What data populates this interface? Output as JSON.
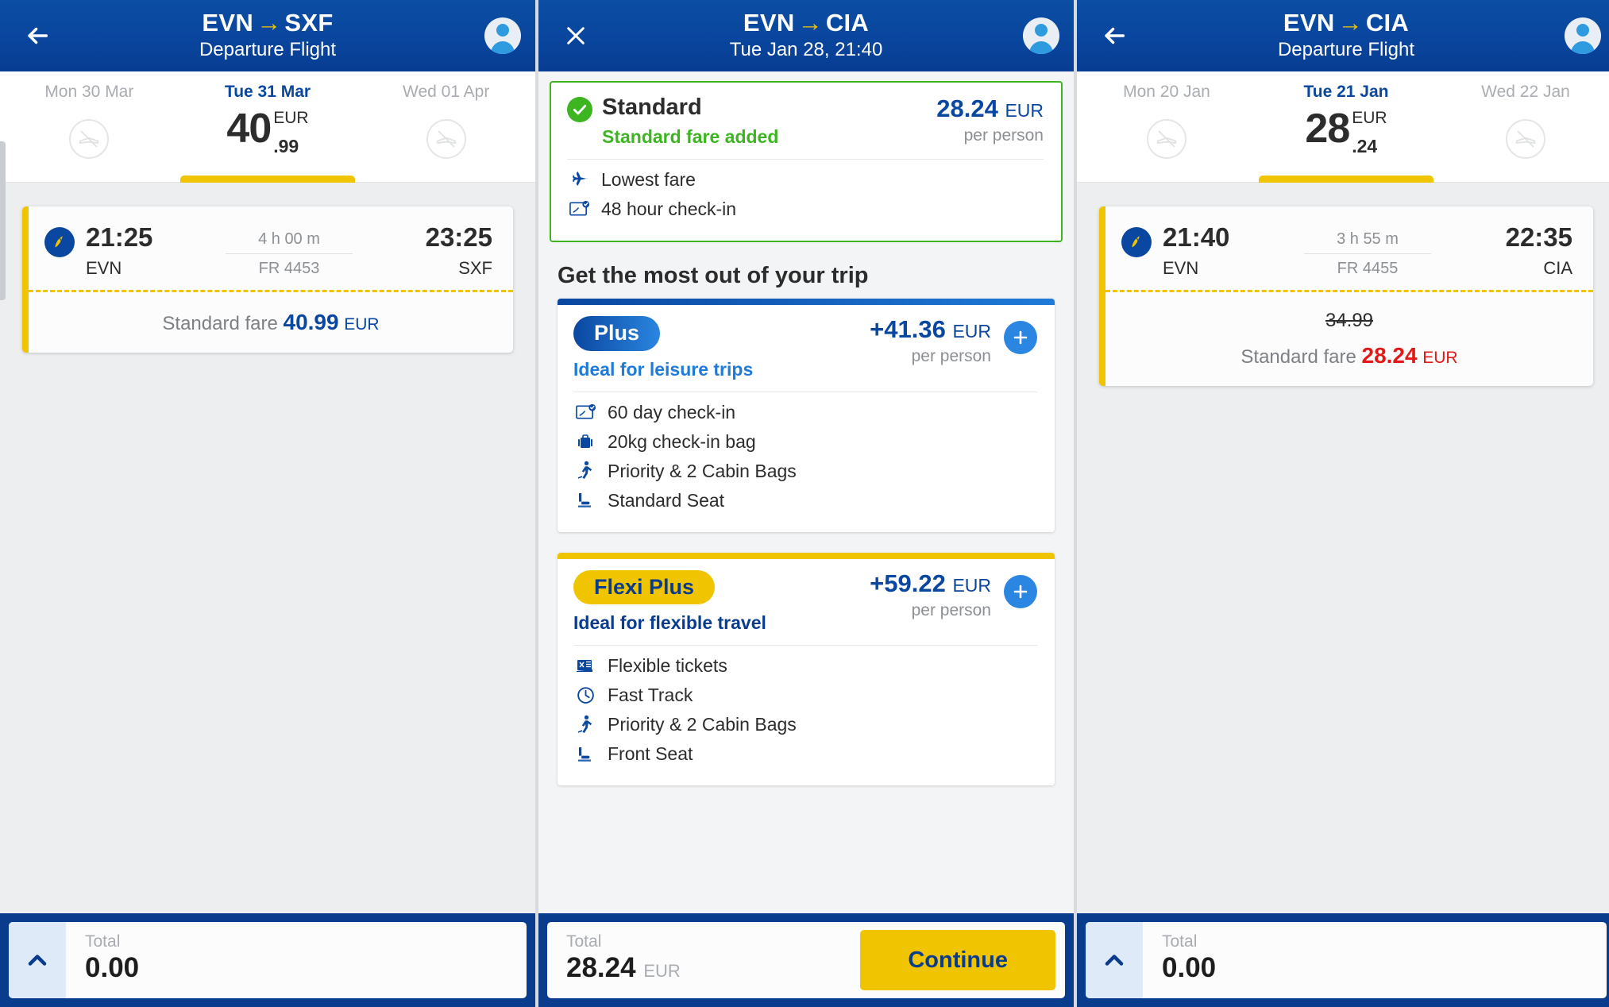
{
  "panels": {
    "left": {
      "header": {
        "back_icon": "back-arrow-icon",
        "route_from": "EVN",
        "route_arrow": "→",
        "route_to": "SXF",
        "subtitle": "Departure Flight",
        "avatar_icon": "account-avatar-icon"
      },
      "dates": [
        {
          "label": "Mon 30 Mar",
          "active": false,
          "no_flight": true
        },
        {
          "label": "Tue 31 Mar",
          "active": true,
          "price_int": "40",
          "price_cur": "EUR",
          "price_dec": ".99"
        },
        {
          "label": "Wed 01 Apr",
          "active": false,
          "no_flight": true
        }
      ],
      "flight": {
        "depart_time": "21:25",
        "depart_airport": "EVN",
        "duration": "4 h 00 m",
        "flight_no": "FR 4453",
        "arrive_time": "23:25",
        "arrive_airport": "SXF",
        "fare_label": "Standard fare",
        "fare_amount": "40.99",
        "fare_currency": "EUR"
      },
      "bottom": {
        "chevron_icon": "chevron-up-icon",
        "total_label": "Total",
        "total_value": "0.00"
      }
    },
    "center": {
      "header": {
        "close_icon": "close-x-icon",
        "route_from": "EVN",
        "route_arrow": "→",
        "route_to": "CIA",
        "subtitle": "Tue Jan 28, 21:40",
        "avatar_icon": "account-avatar-icon"
      },
      "standard": {
        "check_icon": "check-circle-icon",
        "title": "Standard",
        "added_text": "Standard fare added",
        "price": "28.24",
        "currency": "EUR",
        "per_person": "per person",
        "features": [
          {
            "icon": "airplane-icon",
            "label": "Lowest fare"
          },
          {
            "icon": "boarding-pass-check-icon",
            "label": "48 hour check-in"
          }
        ]
      },
      "section_title": "Get the most out of your trip",
      "upgrades": [
        {
          "badge": "Plus",
          "subtitle": "Ideal for leisure trips",
          "price": "+41.36",
          "currency": "EUR",
          "per_person": "per person",
          "add_icon": "plus-circle-icon",
          "features": [
            {
              "icon": "boarding-pass-check-icon",
              "label": "60 day check-in"
            },
            {
              "icon": "suitcase-icon",
              "label": "20kg check-in bag"
            },
            {
              "icon": "priority-walk-icon",
              "label": "Priority & 2 Cabin Bags"
            },
            {
              "icon": "seat-icon",
              "label": "Standard Seat"
            }
          ]
        },
        {
          "badge": "Flexi Plus",
          "subtitle": "Ideal for flexible travel",
          "price": "+59.22",
          "currency": "EUR",
          "per_person": "per person",
          "add_icon": "plus-circle-icon",
          "features": [
            {
              "icon": "flexible-ticket-icon",
              "label": "Flexible tickets"
            },
            {
              "icon": "fast-track-clock-icon",
              "label": "Fast Track"
            },
            {
              "icon": "priority-walk-icon",
              "label": "Priority & 2 Cabin Bags"
            },
            {
              "icon": "seat-icon",
              "label": "Front Seat"
            }
          ]
        }
      ],
      "bottom": {
        "total_label": "Total",
        "total_value": "28.24",
        "total_currency": "EUR",
        "continue_label": "Continue"
      }
    },
    "right": {
      "header": {
        "back_icon": "back-arrow-icon",
        "route_from": "EVN",
        "route_arrow": "→",
        "route_to": "CIA",
        "subtitle": "Departure Flight",
        "avatar_icon": "account-avatar-icon"
      },
      "dates": [
        {
          "label": "Mon 20 Jan",
          "active": false,
          "no_flight": true
        },
        {
          "label": "Tue 21 Jan",
          "active": true,
          "price_int": "28",
          "price_cur": "EUR",
          "price_dec": ".24"
        },
        {
          "label": "Wed 22 Jan",
          "active": false,
          "no_flight": true
        }
      ],
      "flight": {
        "depart_time": "21:40",
        "depart_airport": "EVN",
        "duration": "3 h 55 m",
        "flight_no": "FR 4455",
        "arrive_time": "22:35",
        "arrive_airport": "CIA",
        "old_price": "34.99",
        "fare_label": "Standard fare",
        "fare_amount": "28.24",
        "fare_currency": "EUR"
      },
      "bottom": {
        "chevron_icon": "chevron-up-icon",
        "total_label": "Total",
        "total_value": "0.00"
      }
    }
  },
  "colors": {
    "brand_blue": "#0a47a0",
    "brand_yellow": "#f1c400",
    "success_green": "#3cb521",
    "alert_red": "#e01b17"
  }
}
